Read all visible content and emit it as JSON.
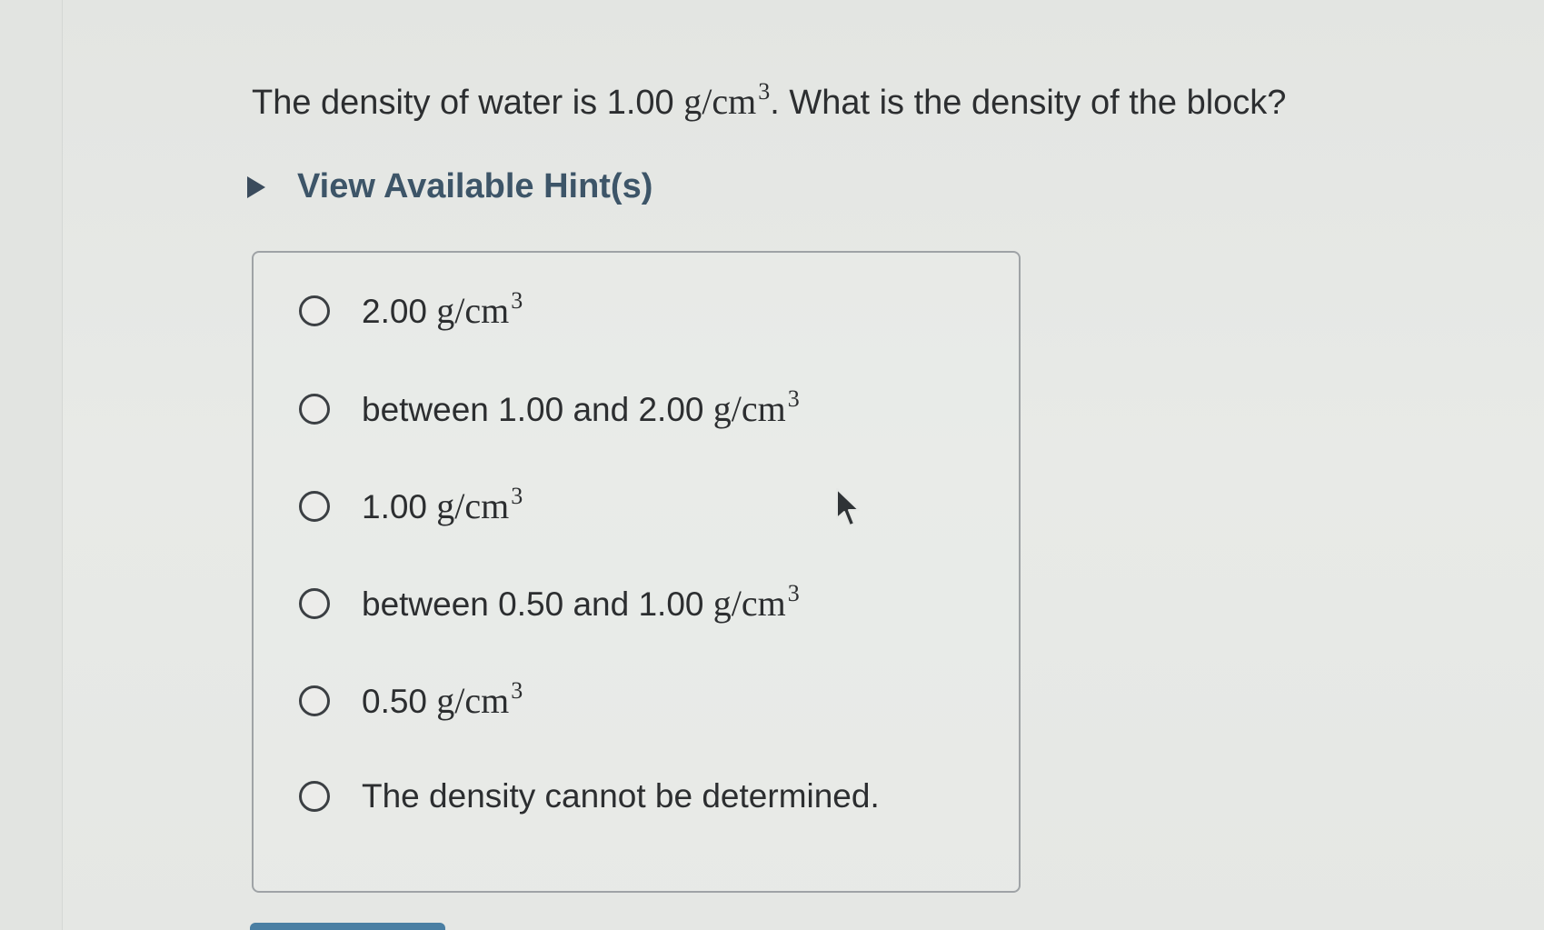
{
  "question": {
    "text_before": "The density of water is 1.00 ",
    "unit": "g/cm",
    "unit_exp": "3",
    "text_after": ". What is the density of the block?"
  },
  "hint": {
    "label": "View Available Hint(s)"
  },
  "choices": [
    {
      "text": "2.00 ",
      "unit": "g/cm",
      "exp": "3"
    },
    {
      "text": "between 1.00 and 2.00 ",
      "unit": "g/cm",
      "exp": "3"
    },
    {
      "text": "1.00 ",
      "unit": "g/cm",
      "exp": "3"
    },
    {
      "text": "between 0.50 and 1.00 ",
      "unit": "g/cm",
      "exp": "3"
    },
    {
      "text": "0.50 ",
      "unit": "g/cm",
      "exp": "3"
    },
    {
      "text": "The density cannot be determined.",
      "unit": "",
      "exp": ""
    }
  ],
  "colors": {
    "hint_text": "#3d5568",
    "border": "#9fa3a6",
    "button": "#4a7fa3"
  },
  "icons": {
    "hint_toggle": "triangle-right-icon",
    "cursor": "mouse-pointer-icon"
  }
}
